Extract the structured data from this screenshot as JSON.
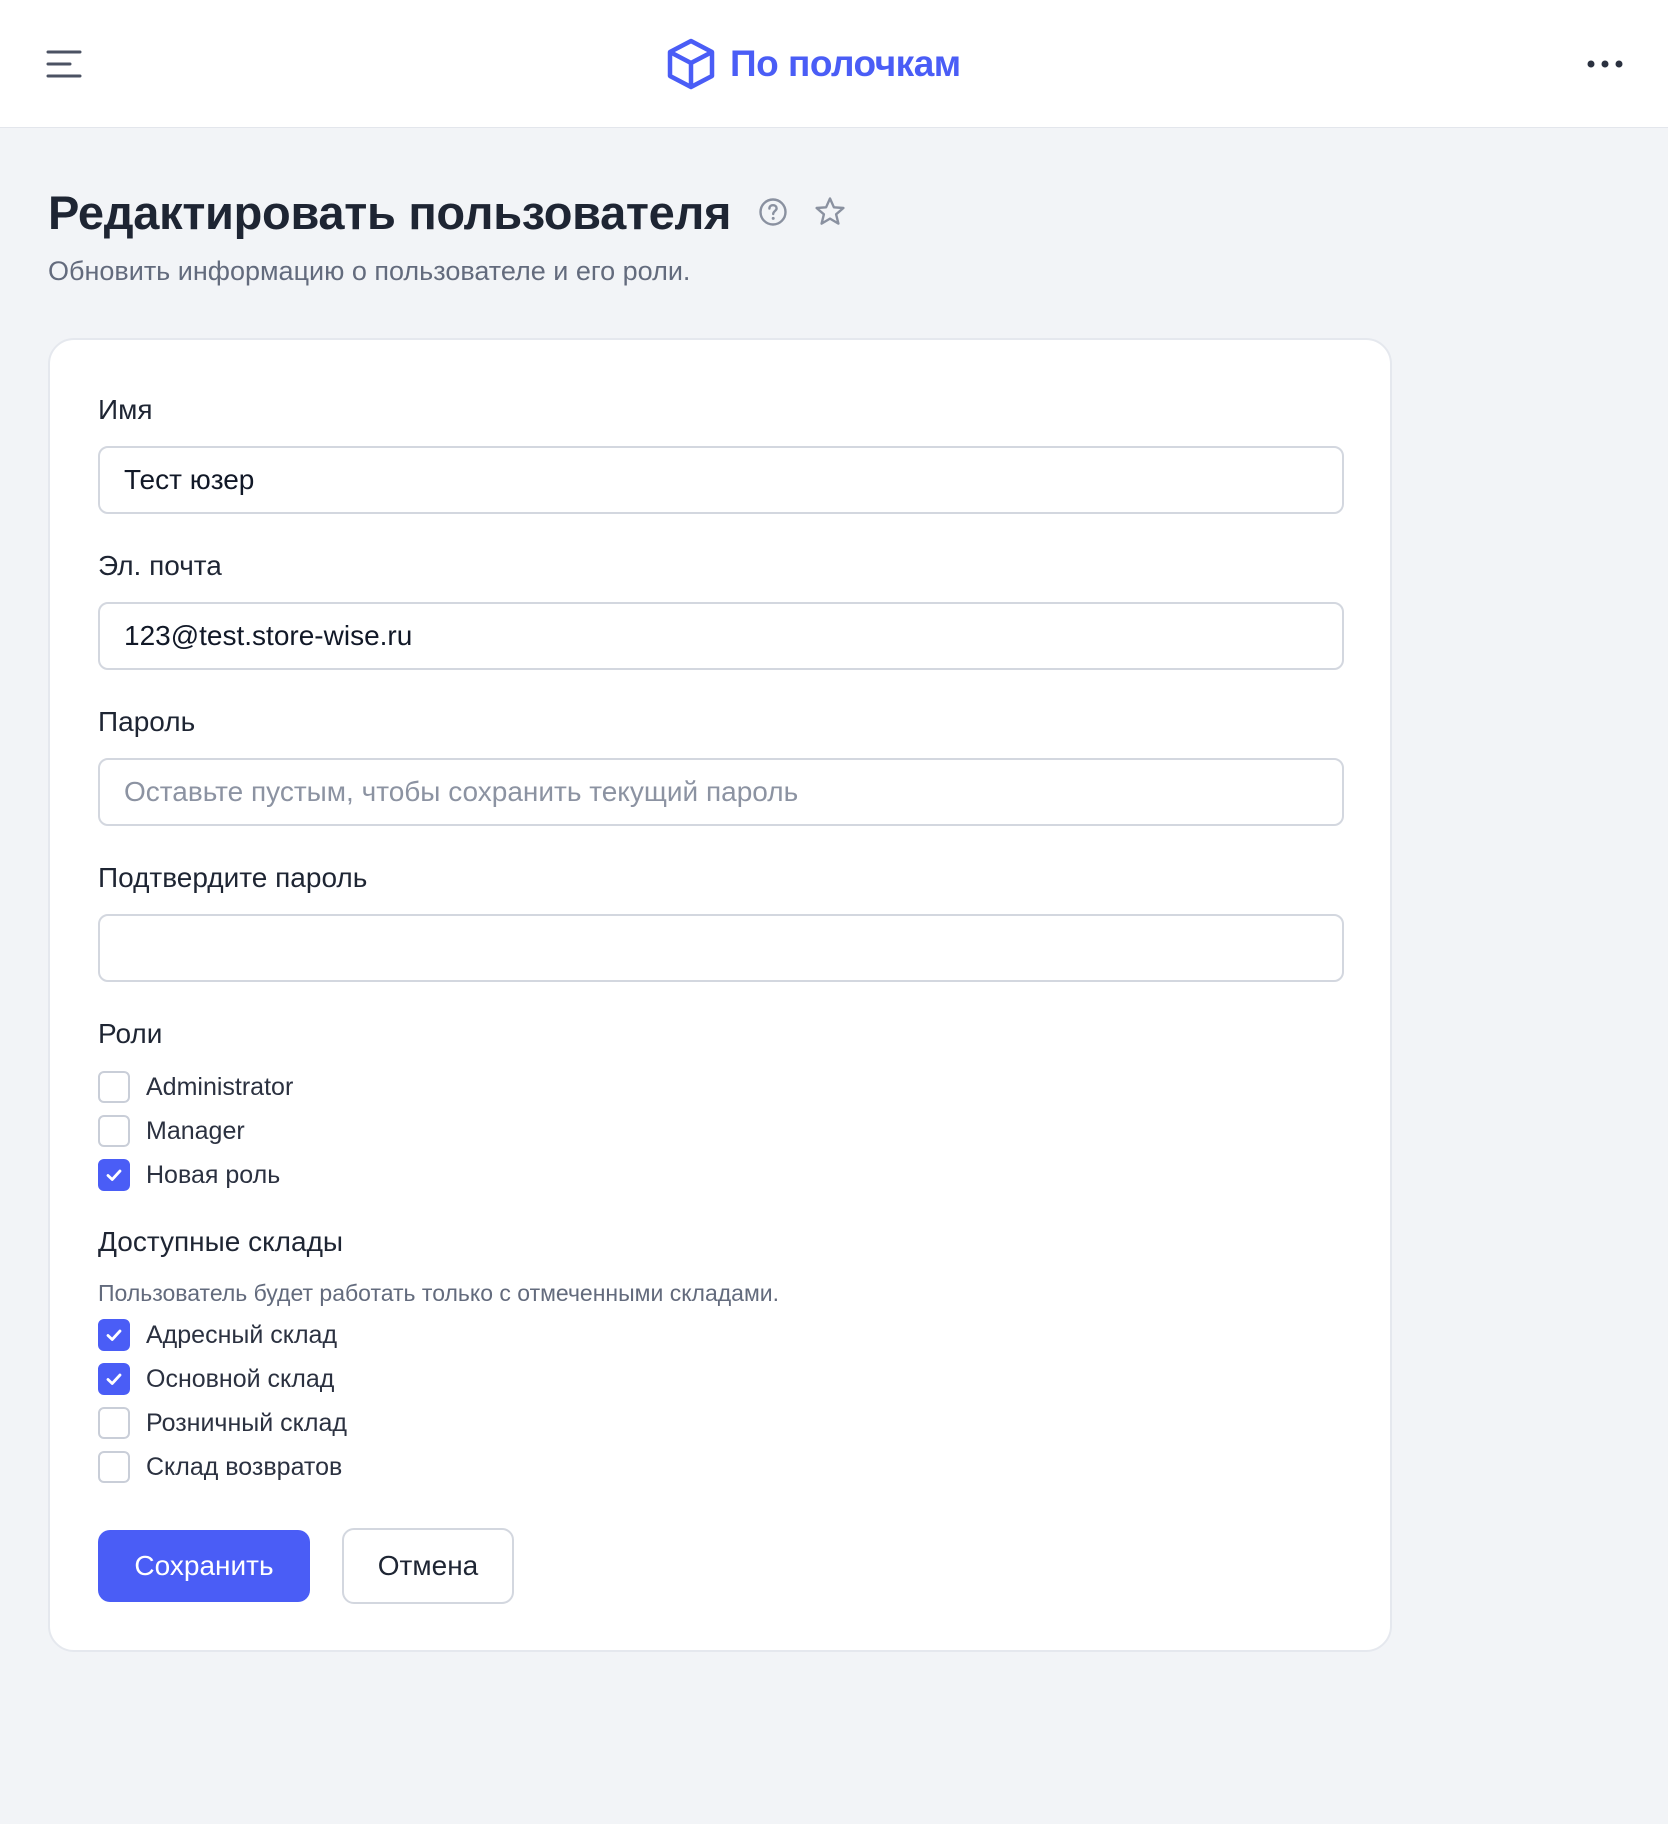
{
  "header": {
    "brand_name": "По полочкам",
    "menu_icon": "hamburger-menu-icon",
    "logo_icon": "box-cube-icon",
    "more_icon": "more-horizontal-icon",
    "brand_color": "#4a5df6"
  },
  "page": {
    "title": "Редактировать пользователя",
    "subtitle": "Обновить информацию о пользователе и его роли.",
    "help_icon": "question-circle-icon",
    "favorite_icon": "star-icon"
  },
  "form": {
    "name": {
      "label": "Имя",
      "value": "Тест юзер"
    },
    "email": {
      "label": "Эл. почта",
      "value": "123@test.store-wise.ru"
    },
    "password": {
      "label": "Пароль",
      "value": "",
      "placeholder": "Оставьте пустым, чтобы сохранить текущий пароль"
    },
    "confirm_password": {
      "label": "Подтвердите пароль",
      "value": ""
    },
    "roles": {
      "label": "Роли",
      "options": [
        {
          "label": "Administrator",
          "checked": false
        },
        {
          "label": "Manager",
          "checked": false
        },
        {
          "label": "Новая роль",
          "checked": true
        }
      ]
    },
    "warehouses": {
      "label": "Доступные склады",
      "help": "Пользователь будет работать только с отмеченными складами.",
      "options": [
        {
          "label": "Адресный склад",
          "checked": true
        },
        {
          "label": "Основной склад",
          "checked": true
        },
        {
          "label": "Розничный склад",
          "checked": false
        },
        {
          "label": "Склад возвратов",
          "checked": false
        }
      ]
    },
    "save_label": "Сохранить",
    "cancel_label": "Отмена"
  },
  "colors": {
    "accent": "#4a5df6",
    "background": "#f2f4f7",
    "card": "#ffffff",
    "border": "#d3d7df"
  }
}
